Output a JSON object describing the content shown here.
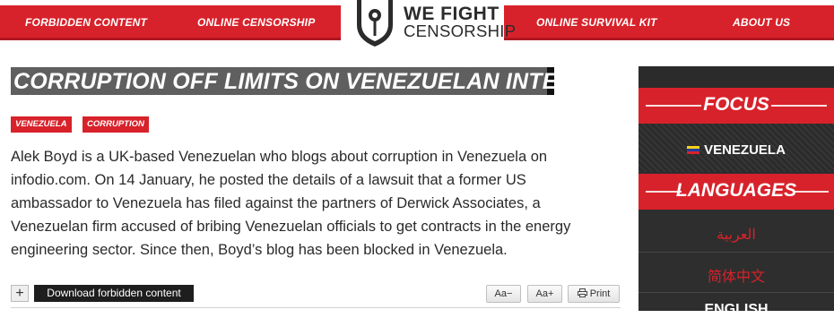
{
  "nav": {
    "items": [
      "FORBIDDEN CONTENT",
      "ONLINE CENSORSHIP",
      "ONLINE SURVIVAL KIT",
      "ABOUT US"
    ]
  },
  "logo": {
    "line1": "WE FIGHT",
    "line2": "CENSORSHIP"
  },
  "article": {
    "title": "CORRUPTION OFF LIMITS ON VENEZUELAN INTERNET",
    "tags": [
      "VENEZUELA",
      "CORRUPTION"
    ],
    "body": "Alek Boyd is a UK-based Venezuelan who blogs about corruption in Venezuela on infodio.com. On 14 January, he posted the details of a lawsuit that a former US ambassador to Venezuela has filed against the partners of Derwick Associates, a Venezuelan firm accused of bribing Venezuelan officials to get contracts in the energy engineering sector. Since then, Boyd’s blog has been blocked in Venezuela."
  },
  "toolbar": {
    "plus": "+",
    "download": "Download forbidden content",
    "font_smaller": "Aa−",
    "font_larger": "Aa+",
    "print": "Print"
  },
  "sidebar": {
    "focus_heading": "FOCUS",
    "focus_item": "VENEZUELA",
    "languages_heading": "LANGUAGES",
    "languages": [
      "العربية",
      "简体中文",
      "ENGLISH"
    ]
  },
  "colors": {
    "brand_red": "#d8222b",
    "dark_panel": "#2e2e2e"
  }
}
